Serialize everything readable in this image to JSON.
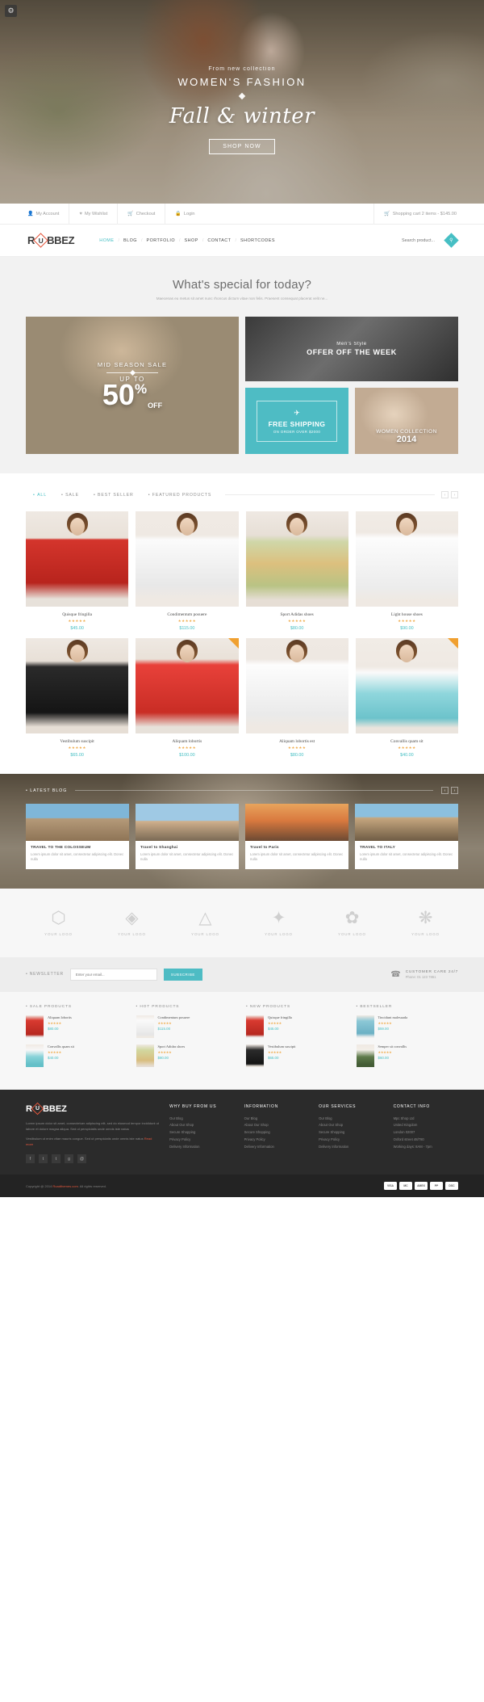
{
  "hero": {
    "pretitle": "From new collection",
    "title": "WOMEN'S FASHION",
    "script_title": "Fall & winter",
    "button": "SHOP NOW",
    "gear_icon": "gear-icon"
  },
  "utility": {
    "links": [
      {
        "label": "My Account",
        "icon": "user-icon"
      },
      {
        "label": "My Wishlist",
        "icon": "heart-icon"
      },
      {
        "label": "Checkout",
        "icon": "cart-icon"
      },
      {
        "label": "Login",
        "icon": "lock-icon"
      }
    ],
    "cart": "Shopping cart 2 items - $145.00",
    "cart_icon": "cart-icon"
  },
  "header": {
    "logo_pre": "R",
    "logo_mid": "U",
    "logo_post": "BBEZ",
    "nav": [
      {
        "label": "HOME",
        "active": true
      },
      {
        "label": "BLOG",
        "active": false
      },
      {
        "label": "PORTFOLIO",
        "active": false
      },
      {
        "label": "SHOP",
        "active": false
      },
      {
        "label": "CONTACT",
        "active": false
      },
      {
        "label": "SHORTCODES",
        "active": false
      }
    ],
    "search_placeholder": "Search product...",
    "search_icon": "search-icon",
    "accent": "#46bfc4"
  },
  "special": {
    "title": "What's special for today?",
    "subtitle": "Maecenas eu metus sit amet nunc rhoncus dictum vitae non felis. Praesent consequat placerat velit ne...",
    "promos": {
      "big": {
        "label": "MID SEASON SALE",
        "upto": "UP TO",
        "number": "50",
        "pct": "%",
        "off": "OFF"
      },
      "men": {
        "small": "Men's Style",
        "big": "OFFER OFF THE WEEK"
      },
      "shipping": {
        "title": "FREE SHIPPING",
        "sub": "ON ORDER OVER $2000",
        "icon": "plane-icon"
      },
      "women": {
        "title": "WOMEN COLLECTION",
        "year": "2014"
      }
    }
  },
  "products": {
    "filters": [
      {
        "label": "ALL",
        "active": true
      },
      {
        "label": "SALE",
        "active": false
      },
      {
        "label": "BEST SELLER",
        "active": false
      },
      {
        "label": "FEATURED PRODUCTS",
        "active": false
      }
    ],
    "items": [
      {
        "name": "Quisque fringilla",
        "price": "$45.00",
        "stars": "★★★★★",
        "sale": false,
        "ph": "ph-red"
      },
      {
        "name": "Condimentum posuere",
        "price": "$115.00",
        "stars": "★★★★★",
        "sale": false,
        "ph": "ph-white1"
      },
      {
        "name": "Sport Adidas shoes",
        "price": "$80.00",
        "stars": "★★★★★",
        "sale": false,
        "ph": "ph-floral"
      },
      {
        "name": "Light house shoes",
        "price": "$90.00",
        "stars": "★★★★★",
        "sale": false,
        "ph": "ph-white2"
      },
      {
        "name": "Vestibulum suscipit",
        "price": "$65.00",
        "stars": "★★★★★",
        "sale": false,
        "ph": "ph-black"
      },
      {
        "name": "Aliquam lobortis",
        "price": "$100.00",
        "stars": "★★★★★",
        "sale": true,
        "ph": "ph-red2"
      },
      {
        "name": "Aliquam lobortis est",
        "price": "$80.00",
        "stars": "★★★★★",
        "sale": false,
        "ph": "ph-white3"
      },
      {
        "name": "Convallis quam sit",
        "price": "$40.00",
        "stars": "★★★★★",
        "sale": true,
        "ph": "ph-aqua"
      }
    ],
    "prev_icon": "chevron-left-icon",
    "next_icon": "chevron-right-icon"
  },
  "blog": {
    "label": "LATEST BLOG",
    "posts": [
      {
        "title": "TRAVEL TO THE COLOSSEUM",
        "desc": "Lorem ipsum dolor sit amet, consectetur adipiscing elit. Donec nulla",
        "img": "bi-colo"
      },
      {
        "title": "Travel to Shanghai",
        "desc": "Lorem ipsum dolor sit amet, consectetur adipiscing elit. Donec nulla",
        "img": "bi-sha"
      },
      {
        "title": "Travel to Paris",
        "desc": "Lorem ipsum dolor sit amet, consectetur adipiscing elit. Donec nulla",
        "img": "bi-par"
      },
      {
        "title": "TRAVEL TO ITALY",
        "desc": "Lorem ipsum dolor sit amet, consectetur adipiscing elit. Donec nulla",
        "img": "bi-ita"
      }
    ]
  },
  "brands": [
    {
      "label": "YOUR LOGO",
      "glyph": "⬡",
      "icon": "hexagon-logo-icon"
    },
    {
      "label": "YOUR LOGO",
      "glyph": "◈",
      "icon": "diamond-logo-icon"
    },
    {
      "label": "YOUR LOGO",
      "glyph": "△",
      "icon": "triangle-logo-icon"
    },
    {
      "label": "YOUR LOGO",
      "glyph": "✦",
      "icon": "star4-logo-icon"
    },
    {
      "label": "YOUR LOGO",
      "glyph": "✿",
      "icon": "flower-logo-icon"
    },
    {
      "label": "YOUR LOGO",
      "glyph": "❋",
      "icon": "snowflake-logo-icon"
    }
  ],
  "newsletter": {
    "label": "NEWSLETTER",
    "placeholder": "Enter your email...",
    "button": "SUBSCRIBE",
    "care_title": "CUSTOMER CARE 24/7",
    "care_phone": "Phone: 01 123 7861",
    "phone_icon": "phone-icon"
  },
  "widgets": [
    {
      "title": "SALE PRODUCTS",
      "items": [
        {
          "name": "Aliquam lobortis",
          "price": "$80.00",
          "stars": "★★★★★",
          "thumb": "wt-red"
        },
        {
          "name": "Convallis quam sit",
          "price": "$40.00",
          "stars": "★★★★★",
          "thumb": "wt-aqua"
        }
      ]
    },
    {
      "title": "HOT PRODUCTS",
      "items": [
        {
          "name": "Condimentum posuere",
          "price": "$115.00",
          "stars": "★★★★★",
          "thumb": "wt-wht"
        },
        {
          "name": "Sport Adidas shoes",
          "price": "$80.00",
          "stars": "★★★★★",
          "thumb": "wt-flo"
        }
      ]
    },
    {
      "title": "NEW PRODUCTS",
      "items": [
        {
          "name": "Quisque fringilla",
          "price": "$45.00",
          "stars": "★★★★★",
          "thumb": "wt-red"
        },
        {
          "name": "Vestibulum suscipit",
          "price": "$65.00",
          "stars": "★★★★★",
          "thumb": "wt-blk"
        }
      ]
    },
    {
      "title": "BESTSELLER",
      "items": [
        {
          "name": "Tincidunt malesuada",
          "price": "$59.00",
          "stars": "★★★★★",
          "thumb": "wt-blu"
        },
        {
          "name": "Semper sit convallis",
          "price": "$60.00",
          "stars": "★★★★★",
          "thumb": "wt-grn"
        }
      ]
    }
  ],
  "footer": {
    "logo_pre": "R",
    "logo_mid": "U",
    "logo_post": "BBEZ",
    "about": "Lorem ipsum dolor sit amet, consectetuer adipiscing elit, sed do eiusmod tempor incididunt ut labore et dolore magna aliqua. Sed ut perspiciatis unde omnis iste natus",
    "about2": "Vestibulum ut enim vitae mauris congue. Sed ut perspiciatis unde omnis iste natus",
    "read_more": "Read more",
    "social": [
      {
        "glyph": "f",
        "icon": "facebook-icon"
      },
      {
        "glyph": "t",
        "icon": "twitter-icon"
      },
      {
        "glyph": "t",
        "icon": "tumblr-icon"
      },
      {
        "glyph": "g",
        "icon": "google-plus-icon"
      },
      {
        "glyph": "@",
        "icon": "instagram-icon"
      }
    ],
    "columns": [
      {
        "title": "WHY BUY FROM US",
        "links": [
          "Our Blog",
          "About Our Shop",
          "Secure Shopping",
          "Privacy Policy",
          "Delivery Information"
        ]
      },
      {
        "title": "INFORMATION",
        "links": [
          "Our Blog",
          "About Our Shop",
          "Secure Shopping",
          "Privacy Policy",
          "Delivery Information"
        ]
      },
      {
        "title": "OUR SERVICES",
        "links": [
          "Our Blog",
          "About Our Shop",
          "Secure Shopping",
          "Privacy Policy",
          "Delivery Information"
        ]
      },
      {
        "title": "CONTACT INFO",
        "links": [
          "Mpc Shop Ltd",
          "United Kingdom",
          "London 02007",
          "Oxford street 48/780",
          "Working days: 8AM - 7pm"
        ]
      }
    ],
    "copyright_pre": "Copyright @ 2014 ",
    "copyright_brand": "Roadthemes.com",
    "copyright_post": ". All rights reserved.",
    "cards": [
      "VISA",
      "MC",
      "AMEX",
      "PP",
      "DSC"
    ]
  }
}
